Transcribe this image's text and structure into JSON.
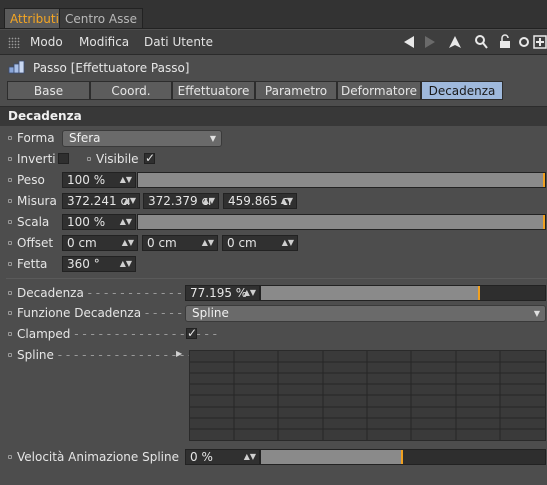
{
  "tabs": [
    {
      "label": "Attributi",
      "active": true
    },
    {
      "label": "Centro Asse",
      "active": false
    }
  ],
  "menu": [
    "Modo",
    "Modifica",
    "Dati Utente"
  ],
  "toolbar_icons": [
    "arrow-left-icon",
    "arrow-right-icon",
    "arrow-up-icon",
    "search-icon",
    "lock-icon",
    "settings-icon",
    "add-panel-icon"
  ],
  "object": {
    "title": "Passo [Effettuatore Passo]",
    "icon": "step-effector-icon"
  },
  "attr_tabs": [
    {
      "label": "Base",
      "active": false
    },
    {
      "label": "Coord.",
      "active": false
    },
    {
      "label": "Effettuatore",
      "active": false
    },
    {
      "label": "Parametro",
      "active": false
    },
    {
      "label": "Deformatore",
      "active": false
    },
    {
      "label": "Decadenza",
      "active": true
    }
  ],
  "section_title": "Decadenza",
  "props": {
    "forma": {
      "label": "Forma",
      "value": "Sfera"
    },
    "inverti": {
      "label": "Inverti",
      "checked": false
    },
    "visibile": {
      "label": "Visibile",
      "checked": true
    },
    "peso": {
      "label": "Peso",
      "value": "100 %",
      "fraction": 1.0
    },
    "misura": {
      "label": "Misura",
      "x": "372.241 cı",
      "y": "372.379 cı",
      "z": "459.865 cı"
    },
    "scala": {
      "label": "Scala",
      "value": "100 %",
      "fraction": 1.0
    },
    "offset": {
      "label": "Offset",
      "x": "0 cm",
      "y": "0 cm",
      "z": "0 cm"
    },
    "fetta": {
      "label": "Fetta",
      "value": "360 °"
    }
  },
  "falloff": {
    "decadenza": {
      "label": "Decadenza",
      "value": "77.195 %",
      "fraction": 0.77195
    },
    "funzione": {
      "label": "Funzione Decadenza",
      "value": "Spline"
    },
    "clamped": {
      "label": "Clamped",
      "checked": true
    },
    "spline": {
      "label": "Spline"
    },
    "velocita": {
      "label": "Velocità Animazione Spline",
      "value": "0 %",
      "fraction": 0.5
    }
  },
  "colors": {
    "accent": "#f5a623",
    "active_tab": "#9fb9dc",
    "knob": "#f0a020"
  }
}
